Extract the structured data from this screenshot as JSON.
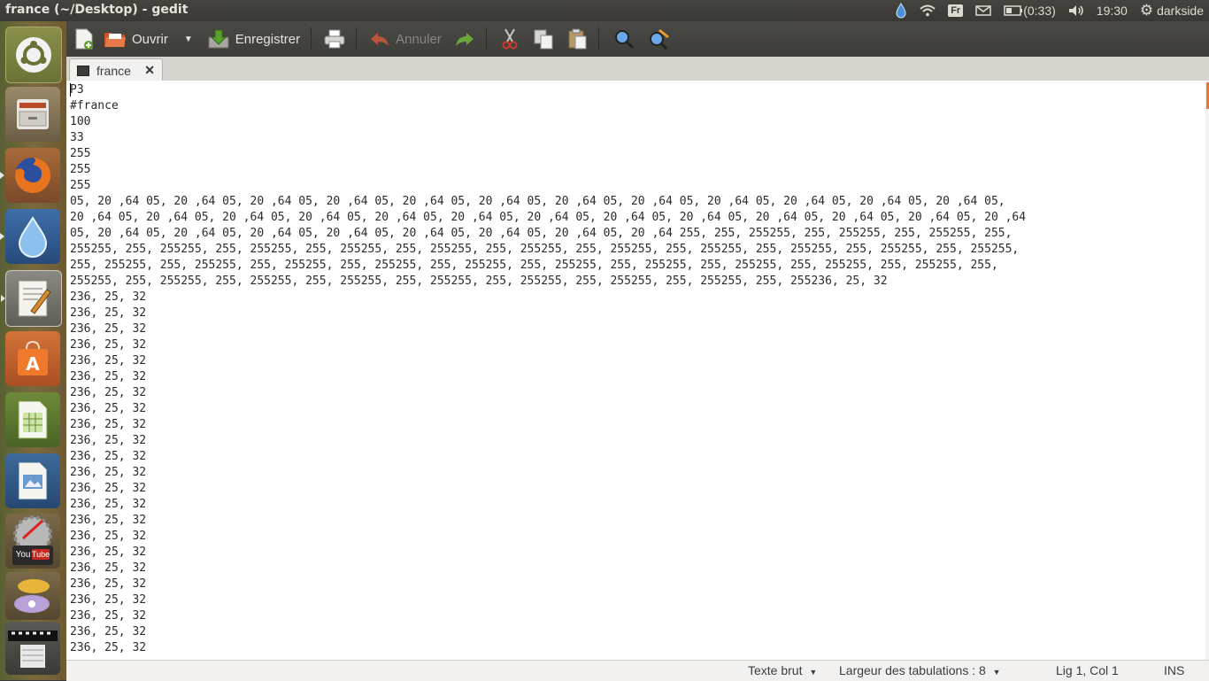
{
  "window": {
    "title": "france (~/Desktop) - gedit"
  },
  "indicators": {
    "language": "Fr",
    "battery": "(0:33)",
    "clock": "19:30",
    "user": "darkside"
  },
  "toolbar": {
    "open_label": "Ouvrir",
    "save_label": "Enregistrer",
    "undo_label": "Annuler"
  },
  "tab": {
    "label": "france",
    "close": "✕"
  },
  "editor": {
    "lines": [
      "P3",
      "#france",
      "100",
      "33",
      "255",
      "255",
      "255",
      "05, 20 ,64 05, 20 ,64 05, 20 ,64 05, 20 ,64 05, 20 ,64 05, 20 ,64 05, 20 ,64 05, 20 ,64 05, 20 ,64 05, 20 ,64 05, 20 ,64 05, 20 ,64 05,",
      "20 ,64 05, 20 ,64 05, 20 ,64 05, 20 ,64 05, 20 ,64 05, 20 ,64 05, 20 ,64 05, 20 ,64 05, 20 ,64 05, 20 ,64 05, 20 ,64 05, 20 ,64 05, 20 ,64",
      "05, 20 ,64 05, 20 ,64 05, 20 ,64 05, 20 ,64 05, 20 ,64 05, 20 ,64 05, 20 ,64 05, 20 ,64 255, 255, 255255, 255, 255255, 255, 255255, 255,",
      "255255, 255, 255255, 255, 255255, 255, 255255, 255, 255255, 255, 255255, 255, 255255, 255, 255255, 255, 255255, 255, 255255, 255, 255255,",
      "255, 255255, 255, 255255, 255, 255255, 255, 255255, 255, 255255, 255, 255255, 255, 255255, 255, 255255, 255, 255255, 255, 255255, 255,",
      "255255, 255, 255255, 255, 255255, 255, 255255, 255, 255255, 255, 255255, 255, 255255, 255, 255255, 255, 255236, 25, 32",
      "236, 25, 32",
      "236, 25, 32",
      "236, 25, 32",
      "236, 25, 32",
      "236, 25, 32",
      "236, 25, 32",
      "236, 25, 32",
      "236, 25, 32",
      "236, 25, 32",
      "236, 25, 32",
      "236, 25, 32",
      "236, 25, 32",
      "236, 25, 32",
      "236, 25, 32",
      "236, 25, 32",
      "236, 25, 32",
      "236, 25, 32",
      "236, 25, 32",
      "236, 25, 32",
      "236, 25, 32",
      "236, 25, 32",
      "236, 25, 32",
      "236, 25, 32"
    ]
  },
  "statusbar": {
    "syntax": "Texte brut",
    "tab_width": "Largeur des tabulations : 8",
    "position": "Lig 1, Col 1",
    "mode": "INS"
  },
  "colors": {
    "accent": "#e6782d",
    "panel": "#3c3b37",
    "editor_bg": "#ffffff"
  }
}
